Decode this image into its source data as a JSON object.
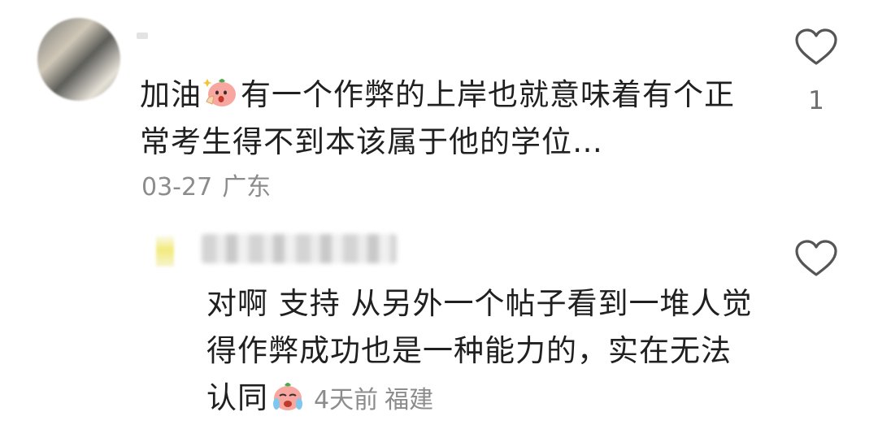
{
  "comment": {
    "username": "",
    "text_part1": "加油",
    "emoji1": "peach-pray-emoji",
    "text_part2": "有一个作弊的上岸也就意味着有个正常考生得不到本该属于他的学位…",
    "date": "03-27",
    "location": "广东",
    "likes": "1",
    "like_icon": "heart-outline-icon"
  },
  "reply": {
    "username": "",
    "text": "对啊 支持 从另外一个帖子看到一堆人觉得作弊成功也是一种能力的，实在无法认同",
    "emoji": "peach-crying-emoji",
    "time": "4天前",
    "location": "福建",
    "like_icon": "heart-outline-icon"
  }
}
